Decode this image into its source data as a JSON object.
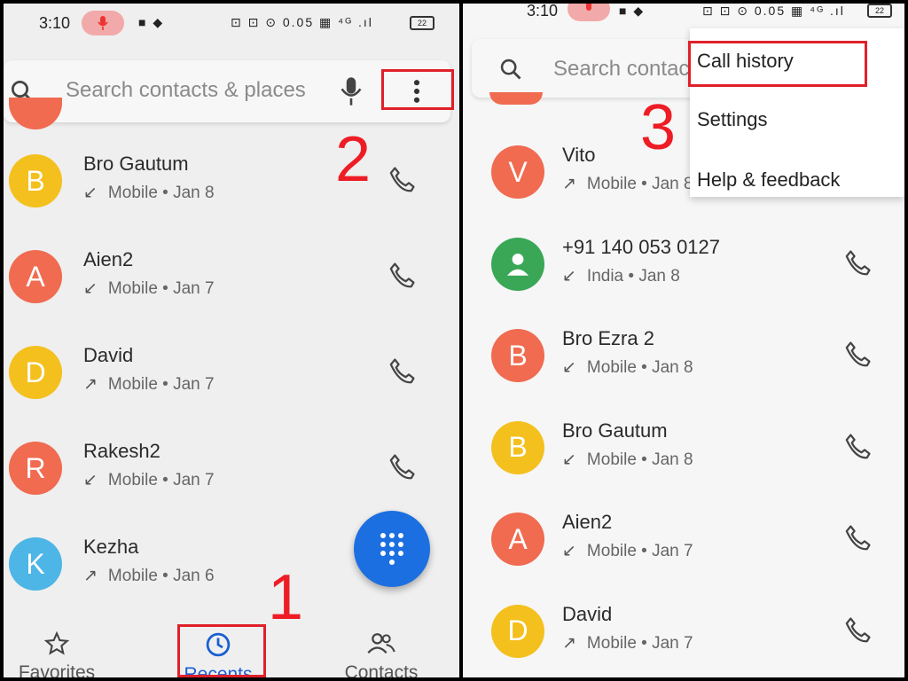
{
  "left": {
    "status_time": "3:10",
    "status_icons_text": "⊡ ⊡ ⊙ 0.05 ▦ ⁴ᴳ .ıl",
    "battery": "22",
    "search_placeholder": "Search contacts & places",
    "contacts": [
      {
        "initial": "B",
        "name": "Bro Gautum",
        "arrow": "↙",
        "meta": "Mobile • Jan 8",
        "color": "#f4c01e"
      },
      {
        "initial": "A",
        "name": "Aien2",
        "arrow": "↙",
        "meta": "Mobile • Jan 7",
        "color": "#f06b50"
      },
      {
        "initial": "D",
        "name": "David",
        "arrow": "↗",
        "meta": "Mobile • Jan 7",
        "color": "#f4c01e"
      },
      {
        "initial": "R",
        "name": "Rakesh2",
        "arrow": "↙",
        "meta": "Mobile • Jan 7",
        "color": "#f06b50"
      },
      {
        "initial": "K",
        "name": "Kezha",
        "arrow": "↗",
        "meta": "Mobile • Jan 6",
        "color": "#4db6e6"
      }
    ],
    "nav": {
      "favorites": "Favorites",
      "recents": "Recents",
      "contacts": "Contacts"
    },
    "annotations": {
      "one": "1",
      "two": "2"
    }
  },
  "right": {
    "status_time": "3:10",
    "status_icons_text": "⊡ ⊡ ⊙ 0.05 ▦ ⁴ᴳ .ıl",
    "battery": "22",
    "search_placeholder": "Search contacts",
    "menu": [
      "Call history",
      "Settings",
      "Help & feedback"
    ],
    "contacts": [
      {
        "initial": "V",
        "name": "Vito",
        "arrow": "↗",
        "meta": "Mobile • Jan 8",
        "color": "#f06b50"
      },
      {
        "initial": "",
        "name": "+91 140 053 0127",
        "arrow": "↙",
        "meta": "India • Jan 8",
        "color": "#3aa757"
      },
      {
        "initial": "B",
        "name": "Bro Ezra 2",
        "arrow": "↙",
        "meta": "Mobile • Jan 8",
        "color": "#f06b50"
      },
      {
        "initial": "B",
        "name": "Bro Gautum",
        "arrow": "↙",
        "meta": "Mobile • Jan 8",
        "color": "#f4c01e"
      },
      {
        "initial": "A",
        "name": "Aien2",
        "arrow": "↙",
        "meta": "Mobile • Jan 7",
        "color": "#f06b50"
      },
      {
        "initial": "D",
        "name": "David",
        "arrow": "↗",
        "meta": "Mobile • Jan 7",
        "color": "#f4c01e"
      }
    ],
    "annotations": {
      "three": "3"
    }
  },
  "colors": {
    "annotation_red": "#e0202a",
    "fab_blue": "#1c6fe0",
    "recents_blue": "#1a5fd1"
  },
  "icons": [
    "search-icon",
    "mic-icon",
    "more-vert-icon",
    "phone-icon",
    "dialpad-icon",
    "star-icon",
    "clock-icon",
    "contacts-icon",
    "person-icon"
  ]
}
